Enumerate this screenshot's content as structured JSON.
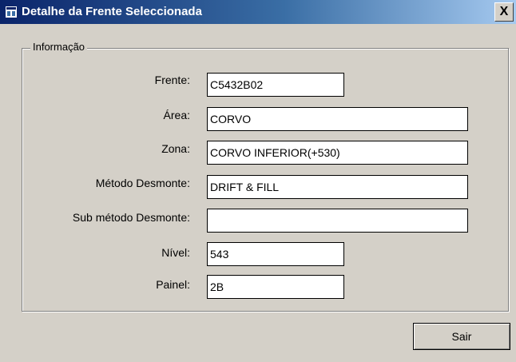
{
  "window": {
    "title": "Detalhe da Frente Seleccionada",
    "close_label": "X"
  },
  "group": {
    "legend": "Informação"
  },
  "fields": [
    {
      "label": "Frente:",
      "value": "C5432B02"
    },
    {
      "label": "Área:",
      "value": "CORVO"
    },
    {
      "label": "Zona:",
      "value": "CORVO INFERIOR(+530)"
    },
    {
      "label": "Método Desmonte:",
      "value": "DRIFT & FILL"
    },
    {
      "label": "Sub método Desmonte:",
      "value": ""
    },
    {
      "label": "Nível:",
      "value": "543"
    },
    {
      "label": "Painel:",
      "value": "2B"
    }
  ],
  "buttons": {
    "exit_label": "Sair"
  },
  "colors": {
    "window_bg": "#d4d0c8",
    "titlebar_dark": "#0a246a",
    "titlebar_light": "#a6caf0",
    "field_bg": "#ffffff"
  }
}
